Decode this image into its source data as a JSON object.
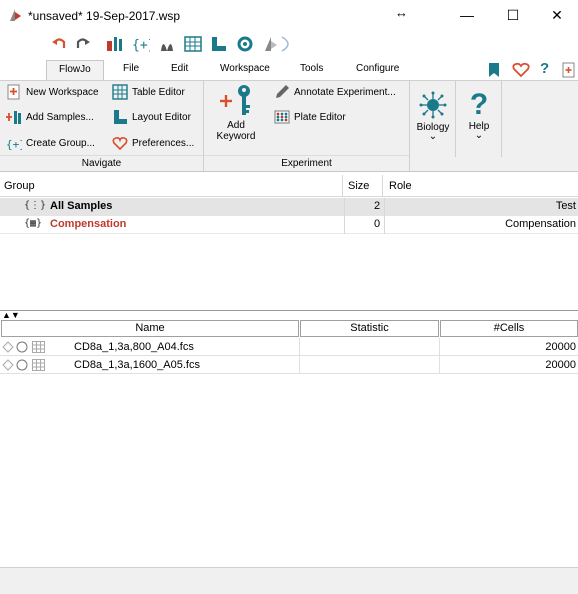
{
  "window": {
    "title": "*unsaved* 19-Sep-2017.wsp",
    "resize_glyph": "↔",
    "minimize_glyph": "—",
    "maximize_glyph": "☐",
    "close_glyph": "✕"
  },
  "menu": {
    "tabs": [
      "FlowJo",
      "File",
      "Edit",
      "Workspace",
      "Tools",
      "Configure"
    ],
    "active_tab": "FlowJo",
    "right_icons": [
      "bookmark-icon",
      "heart-icon",
      "help-icon",
      "new-doc-icon"
    ],
    "help_glyph": "?"
  },
  "ribbon": {
    "navigate": {
      "label": "Navigate",
      "items": [
        {
          "label": "New Workspace",
          "icon": "new-workspace-icon"
        },
        {
          "label": "Add Samples...",
          "icon": "add-samples-icon"
        },
        {
          "label": "Create Group...",
          "icon": "create-group-icon"
        },
        {
          "label": "Table Editor",
          "icon": "table-editor-icon"
        },
        {
          "label": "Layout Editor",
          "icon": "layout-editor-icon"
        },
        {
          "label": "Preferences...",
          "icon": "preferences-icon"
        }
      ]
    },
    "experiment": {
      "label": "Experiment",
      "add_keyword_line1": "Add",
      "add_keyword_line2": "Keyword",
      "annotate": "Annotate Experiment...",
      "plate_editor": "Plate Editor"
    },
    "biology": {
      "label": "Biology",
      "chevron": "⌄"
    },
    "help": {
      "label": "Help",
      "glyph": "?",
      "chevron": "⌄"
    }
  },
  "group_table": {
    "columns": [
      "Group",
      "Size",
      "Role"
    ],
    "rows": [
      {
        "name": "All Samples",
        "size": "2",
        "role": "Test",
        "icon": "{⋮}"
      },
      {
        "name": "Compensation",
        "size": "0",
        "role": "Compensation",
        "icon": "{▦}"
      }
    ]
  },
  "sample_table": {
    "columns": [
      "Name",
      "Statistic",
      "#Cells"
    ],
    "rows": [
      {
        "name": "CD8a_1,3a,800_A04.fcs",
        "statistic": "",
        "cells": "20000"
      },
      {
        "name": "CD8a_1,3a,1600_A05.fcs",
        "statistic": "",
        "cells": "20000"
      }
    ]
  },
  "splitter_glyph": "▲▼",
  "colors": {
    "accent_red": "#c0392b",
    "teal": "#1a7a8a",
    "compensation_red": "#c0392b"
  }
}
